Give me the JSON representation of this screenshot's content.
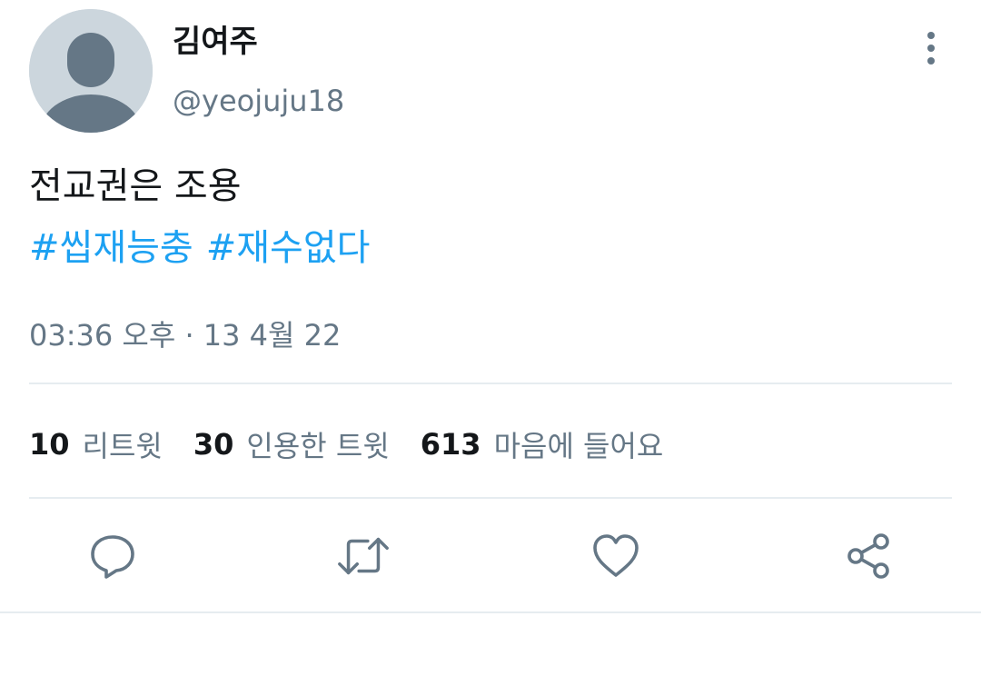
{
  "user": {
    "display_name": "김여주",
    "handle": "@yeojuju18",
    "avatar_icon": "default-avatar-icon"
  },
  "tweet": {
    "text": "전교권은 조용",
    "hashtags": [
      "#씹재능충",
      "#재수없다"
    ],
    "timestamp": "03:36 오후 · 13 4월 22"
  },
  "stats": {
    "retweets": {
      "count": "10",
      "label": "리트윗"
    },
    "quotes": {
      "count": "30",
      "label": "인용한 트윗"
    },
    "likes": {
      "count": "613",
      "label": "마음에 들어요"
    }
  },
  "actions": {
    "icons": [
      "reply-icon",
      "retweet-icon",
      "like-icon",
      "share-icon"
    ]
  },
  "colors": {
    "accent": "#1da1f2",
    "secondary_text": "#657786",
    "primary_text": "#14171a",
    "divider": "#e6ecf0",
    "avatar_bg": "#ccd6dd",
    "avatar_fg": "#657786"
  }
}
